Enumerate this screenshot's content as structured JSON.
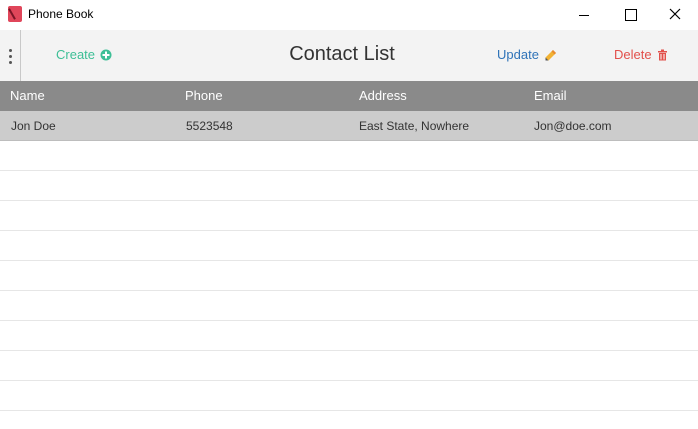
{
  "window": {
    "title": "Phone Book",
    "icon": "phone-book-icon"
  },
  "toolbar": {
    "title": "Contact List",
    "create_label": "Create",
    "update_label": "Update",
    "delete_label": "Delete"
  },
  "colors": {
    "create": "#3dbf96",
    "update": "#2f73b8",
    "delete": "#e2504b",
    "header_bg": "#8a8a8a",
    "selected_row": "#cccccc"
  },
  "table": {
    "columns": [
      "Name",
      "Phone",
      "Address",
      "Email"
    ],
    "rows": [
      [
        "Jon Doe",
        "5523548",
        "East State, Nowhere",
        "Jon@doe.com"
      ]
    ]
  }
}
